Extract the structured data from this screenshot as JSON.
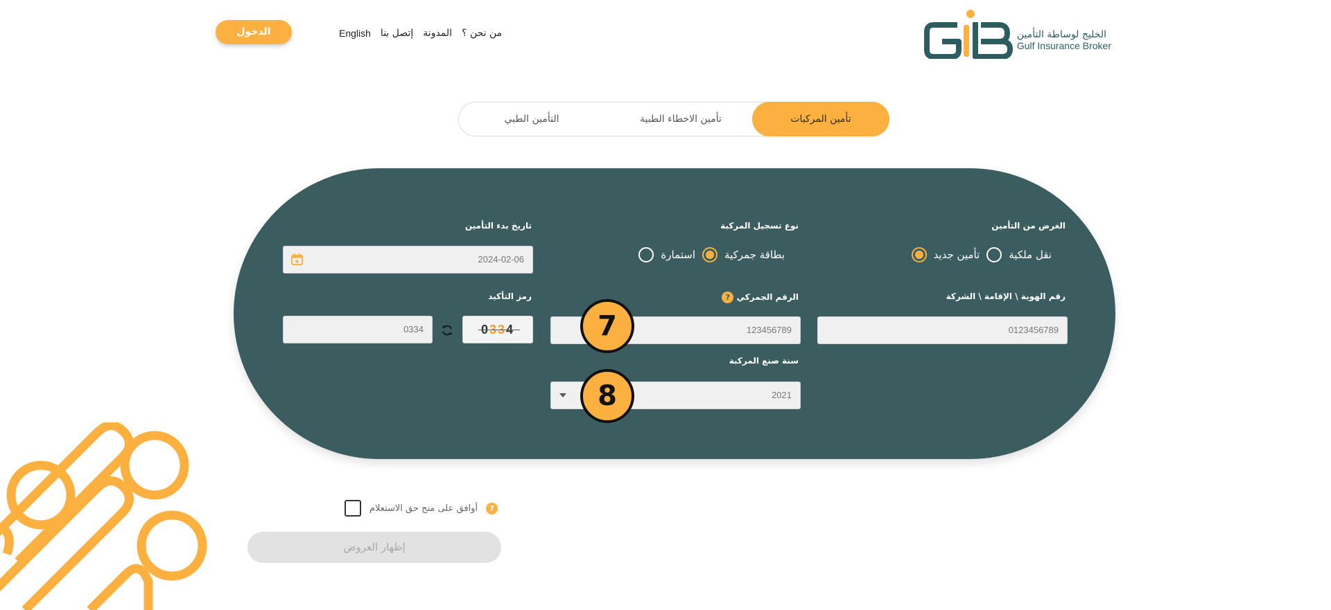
{
  "header": {
    "login_label": "الدخول",
    "nav": [
      "من نحن ؟",
      "المدونة",
      "إتصل بنا",
      "English"
    ],
    "logo_ar": "الخليج لوساطة التأمين",
    "logo_en": "Gulf Insurance Broker"
  },
  "tabs": {
    "motor": "تأمين المركبات",
    "malpractice": "تأمين الاخطاء الطبية",
    "medical": "التأمين الطبي",
    "active": "motor"
  },
  "form": {
    "purpose": {
      "label": "الغرض من التأمين",
      "options": [
        "تأمين جديد",
        "نقل ملكية"
      ],
      "selected": "تأمين جديد"
    },
    "registration_type": {
      "label": "نوع تسجيل المركبة",
      "options": [
        "استمارة",
        "بطاقة جمركية"
      ],
      "selected": "بطاقة جمركية"
    },
    "start_date": {
      "label": "تاريخ بدء التأمين",
      "value": "2024-02-06"
    },
    "id_number": {
      "label": "رقم الهوية \\ الإقامة \\ الشركة",
      "value": "0123456789"
    },
    "customs_number": {
      "label": "الرقم الجمركي",
      "value": "123456789"
    },
    "captcha": {
      "label": "رمز التأكيد",
      "image_text_1": "0",
      "image_text_2": "33",
      "image_text_3": "4",
      "input_value": "0334"
    },
    "manufacture_year": {
      "label": "سنة صنع المركبة",
      "value": "2021"
    }
  },
  "annotations": {
    "badge_7": "7",
    "badge_8": "8"
  },
  "consent": {
    "label": "أوافق على منح حق الاستعلام"
  },
  "show_offers_label": "إظهار العروض",
  "colors": {
    "accent": "#fbb040",
    "card": "#3c5d60",
    "brand_dark": "#2e5d5f"
  }
}
